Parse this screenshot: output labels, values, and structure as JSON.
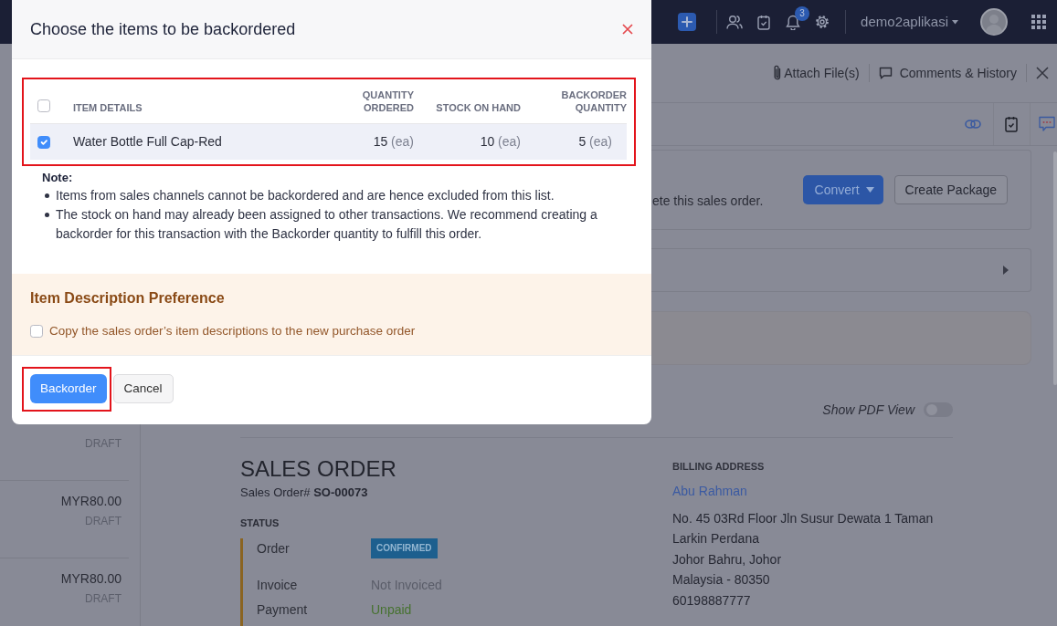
{
  "navbar": {
    "notification_count": "3",
    "account": "demo2aplikasi"
  },
  "detail_header": {
    "actions": [
      {
        "kind": "attach",
        "label": "Attach File(s)"
      },
      {
        "kind": "comments",
        "label": "Comments & History"
      }
    ]
  },
  "sidebar": {
    "items": [
      {
        "status": "DRAFT"
      },
      {
        "amount": "MYR80.00",
        "status": "DRAFT"
      },
      {
        "amount": "MYR80.00",
        "status": "DRAFT"
      }
    ]
  },
  "banner": {
    "text": "ete this sales order.",
    "buttons": [
      {
        "kind": "dropdown",
        "label": "Convert"
      },
      {
        "kind": "plain",
        "label": "Create Package"
      }
    ]
  },
  "pdf_view": {
    "label": "Show PDF View",
    "on": false
  },
  "document": {
    "title": "SALES ORDER",
    "number": "Sales Order# **SO-00073**",
    "status_heading": "STATUS",
    "statuses": [
      {
        "kind": "badge",
        "label": "Order",
        "value": "CONFIRMED"
      },
      {
        "kind": "muted",
        "label": "Invoice",
        "value": "Not Invoiced"
      },
      {
        "kind": "success",
        "label": "Payment",
        "value": "Unpaid"
      }
    ],
    "billing": {
      "heading": "BILLING ADDRESS",
      "name": "Abu Rahman",
      "lines": [
        "No. 45 03Rd Floor Jln Susur Dewata 1 Taman",
        "Larkin Perdana",
        "Johor Bahru, Johor",
        "Malaysia - 80350",
        "60198887777"
      ]
    }
  },
  "modal": {
    "title": "Choose the items to be backordered",
    "table": {
      "highlighted": true,
      "select_all": false,
      "columns": [
        "ITEM DETAILS",
        "QUANTITY ORDERED",
        "STOCK ON HAND",
        "BACKORDER QUANTITY"
      ],
      "rows": [
        {
          "selected": true,
          "cells": [
            {
              "value": "Water Bottle Full Cap-Red"
            },
            {
              "value": "15",
              "unit": "(ea)"
            },
            {
              "value": "10",
              "unit": "(ea)"
            },
            {
              "value": "5",
              "unit": "(ea)"
            }
          ]
        }
      ]
    },
    "note": {
      "heading": "Note:",
      "items": [
        "Items from sales channels cannot be backordered and are hence excluded from this list.",
        "The stock on hand may already been assigned to other transactions. We recommend creating a backorder for this transaction with the Backorder quantity to fulfill this order."
      ]
    },
    "preference": {
      "title": "Item Description Preference",
      "label": "Copy the sales order’s item descriptions to the new purchase order",
      "checked": false
    },
    "buttons": [
      {
        "kind": "primary",
        "label": "Backorder",
        "highlighted": true
      },
      {
        "kind": "secondary",
        "label": "Cancel",
        "highlighted": false
      }
    ]
  }
}
